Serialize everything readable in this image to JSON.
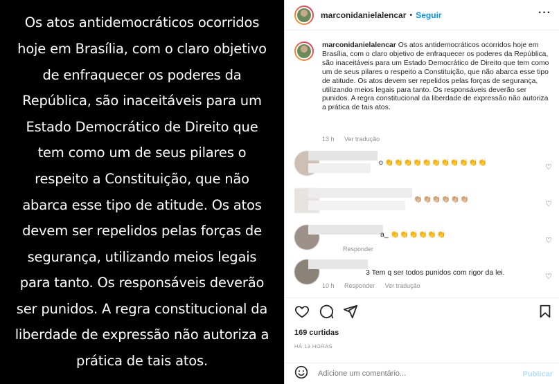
{
  "media": {
    "lines": [
      "Os atos antidemocráticos ocorridos",
      "hoje em Brasília, com o claro objetivo",
      "de enfraquecer os poderes da",
      "República, são  inaceitáveis para um",
      "Estado Democrático de Direito que",
      "tem como um de seus pilares o",
      "respeito a Constituição, que não",
      "abarca esse tipo de atitude. Os atos",
      "devem ser repelidos pelas forças de",
      "segurança, utilizando meios legais",
      "para tanto. Os responsáveis deverão",
      "ser punidos. A regra constitucional da",
      "liberdade de expressão não autoriza a",
      "prática de tais atos."
    ]
  },
  "header": {
    "username": "marconidanielalencar",
    "separator": "•",
    "follow_label": "Seguir",
    "more_icon": "more-horizontal-icon"
  },
  "caption": {
    "username": "marconidanielalencar",
    "text": "Os atos antidemocráticos ocorridos hoje em Brasília, com o claro objetivo de enfraquecer os poderes da República, são inaceitáveis para um Estado Democrático de Direito que tem como um de seus pilares o respeito a Constituição, que não abarca esse tipo de atitude. Os atos devem ser repelidos pelas forças de segurança, utilizando meios legais para tanto. Os responsáveis deverão ser punidos. A regra constitucional da liberdade de expressão não autoriza a prática de tais atos.",
    "time": "13 h",
    "translate": "Ver tradução"
  },
  "comments": [
    {
      "text_suffix": "o",
      "emojis": "👏👏👏👏👏👏👏👏👏👏👏",
      "meta": []
    },
    {
      "text_suffix": "",
      "emojis": "👏🏼👏🏼👏🏼👏🏼👏🏼👏🏼",
      "meta": []
    },
    {
      "text_suffix": "a_",
      "emojis": "👏👏👏👏👏👏",
      "meta": [
        "Responder"
      ]
    },
    {
      "text_suffix": "3 Tem q ser todos punidos com rigor da lei.",
      "emojis": "",
      "meta": [
        "10 h",
        "Responder",
        "Ver tradução"
      ]
    }
  ],
  "actions": {
    "icons": [
      "heart-icon",
      "comment-icon",
      "share-icon",
      "bookmark-icon"
    ]
  },
  "likes": "169 curtidas",
  "timestamp": "HÁ 13 HORAS",
  "add_comment": {
    "placeholder": "Adicione um comentário...",
    "publish_label": "Publicar"
  },
  "colors": {
    "accent": "#0095f6",
    "publish_disabled": "#b2dffc",
    "muted": "#8e8e8e",
    "text": "#262626"
  }
}
